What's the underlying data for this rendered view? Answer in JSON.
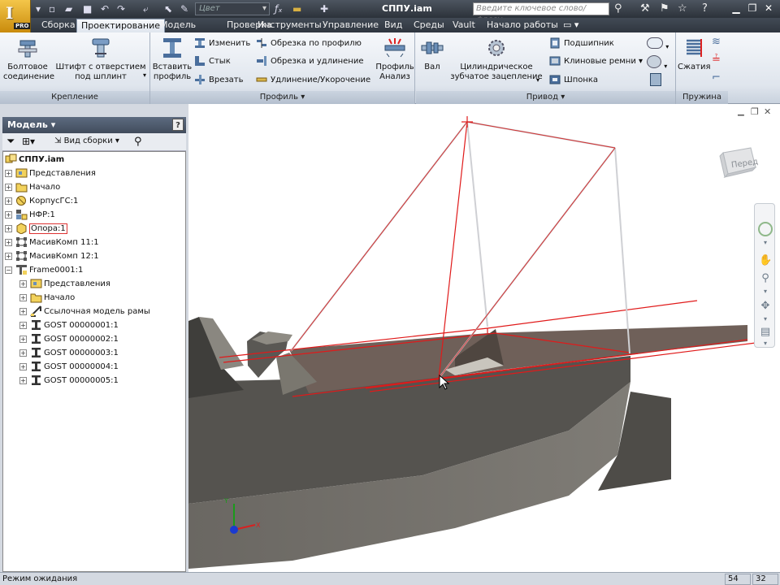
{
  "app": {
    "pro_badge": "PRO",
    "doc_title": "СППУ.iam"
  },
  "quick_access": {
    "color_combo": "Цвет",
    "search_placeholder": "Введите ключевое слово/фразу"
  },
  "tabs": [
    "Сборка",
    "Проектирование",
    "Модель",
    "Проверка",
    "Инструменты",
    "Управление",
    "Вид",
    "Среды",
    "Vault",
    "Начало работы"
  ],
  "active_tab": "Проектирование",
  "ribbon": {
    "fastening": {
      "title": "Крепление",
      "bolt_line1": "Болтовое",
      "bolt_line2": "соединение",
      "pin_line1": "Штифт с отверстием",
      "pin_line2": "под шплинт"
    },
    "profile": {
      "title": "Профиль",
      "insert_line1": "Вставить",
      "insert_line2": "профиль",
      "change": "Изменить",
      "joint": "Стык",
      "notch": "Врезать",
      "trim_profile": "Обрезка по профилю",
      "trim_extend": "Обрезка и удлинение",
      "lengthen": "Удлинение/Укорочение"
    },
    "analysis": {
      "line1": "Профиль",
      "line2": "Анализ"
    },
    "drive": {
      "title": "Привод",
      "shaft": "Вал",
      "gear_line1": "Цилиндрическое",
      "gear_line2": "зубчатое зацепление",
      "bearing": "Подшипник",
      "vbelts": "Клиновые ремни",
      "key": "Шпонка"
    },
    "spring": {
      "title": "Пружина",
      "compression": "Сжатия"
    }
  },
  "browser": {
    "title": "Модель",
    "help": "?",
    "assembly_view": "Вид сборки",
    "tree": [
      {
        "label": "СППУ.iam",
        "level": 0,
        "icon": "assembly-icon",
        "expander": "",
        "bold": true
      },
      {
        "label": "Представления",
        "level": 1,
        "icon": "representations-icon",
        "expander": "+"
      },
      {
        "label": "Начало",
        "level": 1,
        "icon": "folder-icon",
        "expander": "+"
      },
      {
        "label": "КорпусГС:1",
        "level": 1,
        "icon": "part-icon",
        "expander": "+"
      },
      {
        "label": "НФР:1",
        "level": 1,
        "icon": "subassembly-icon",
        "expander": "+"
      },
      {
        "label": "Опора:1",
        "level": 1,
        "icon": "part-yellow-icon",
        "expander": "+",
        "selected": true
      },
      {
        "label": "МасивКомп 11:1",
        "level": 1,
        "icon": "pattern-icon",
        "expander": "+"
      },
      {
        "label": "МасивКомп 12:1",
        "level": 1,
        "icon": "pattern-icon",
        "expander": "+"
      },
      {
        "label": "Frame0001:1",
        "level": 1,
        "icon": "frame-icon",
        "expander": "−"
      },
      {
        "label": "Представления",
        "level": 2,
        "icon": "representations-icon",
        "expander": "+"
      },
      {
        "label": "Начало",
        "level": 2,
        "icon": "folder-icon",
        "expander": "+"
      },
      {
        "label": "Ссылочная модель рамы",
        "level": 2,
        "icon": "skeleton-icon",
        "expander": "+"
      },
      {
        "label": "GOST  00000001:1",
        "level": 2,
        "icon": "ibeam-icon",
        "expander": "+"
      },
      {
        "label": "GOST  00000002:1",
        "level": 2,
        "icon": "ibeam-icon",
        "expander": "+"
      },
      {
        "label": "GOST  00000003:1",
        "level": 2,
        "icon": "ibeam-icon",
        "expander": "+"
      },
      {
        "label": "GOST  00000004:1",
        "level": 2,
        "icon": "ibeam-icon",
        "expander": "+"
      },
      {
        "label": "GOST  00000005:1",
        "level": 2,
        "icon": "ibeam-icon",
        "expander": "+"
      }
    ]
  },
  "viewcube": {
    "face_label": "Перед"
  },
  "triad": {
    "y": "Y",
    "x": "X"
  },
  "status": {
    "text": "Режим ожидания",
    "num1": "54",
    "num2": "32"
  },
  "colors": {
    "accent_red": "#e01a1a",
    "hull": "#5c5a55",
    "deck": "#6d5e56"
  }
}
